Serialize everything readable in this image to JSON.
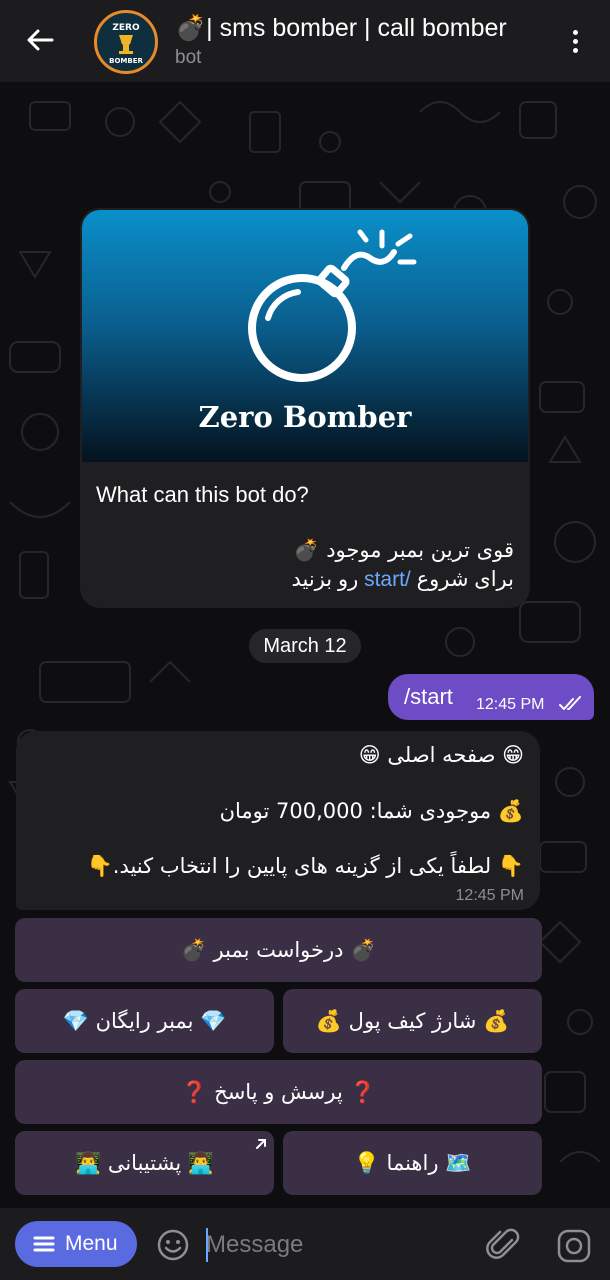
{
  "header": {
    "title": "💣| sms bomber | call bomber",
    "subtitle": "bot",
    "avatar_text_top": "ZERO",
    "avatar_text_bottom": "BOMBER"
  },
  "intro_card": {
    "media_title": "Zero Bomber",
    "heading": "What can this bot do?",
    "line1": "قوی ترین بمبر موجود 💣",
    "line2_prefix": "برای شروع ",
    "line2_link": "/start",
    "line2_suffix": " رو بزنید"
  },
  "date_separator": "March 12",
  "outgoing_message": {
    "text": "/start",
    "time": "12:45 PM"
  },
  "incoming_message": {
    "line1": "😁 صفحه اصلی 😁",
    "line2": "💰 موجودی شما: 700,000 تومان",
    "line3": "👇 لطفاً یکی از گزینه های پایین را انتخاب کنید.👇",
    "time": "12:45 PM"
  },
  "keyboard": {
    "request_bomber": "💣 درخواست بمبر 💣",
    "charge_wallet": "💰 شارژ کیف پول 💰",
    "free_bomber": "💎 بمبر رایگان 💎",
    "faq": "❓ پرسش و پاسخ ❓",
    "guide": "🗺️ راهنما 💡",
    "support": "👨‍💻 پشتیبانی 👨‍💻"
  },
  "input_bar": {
    "menu_label": "Menu",
    "placeholder": "Message"
  },
  "colors": {
    "accent_purple": "#6d4cc6",
    "menu_blue": "#5a6ae0",
    "keyboard_button": "#3a2f45",
    "link": "#6aa9ff"
  }
}
